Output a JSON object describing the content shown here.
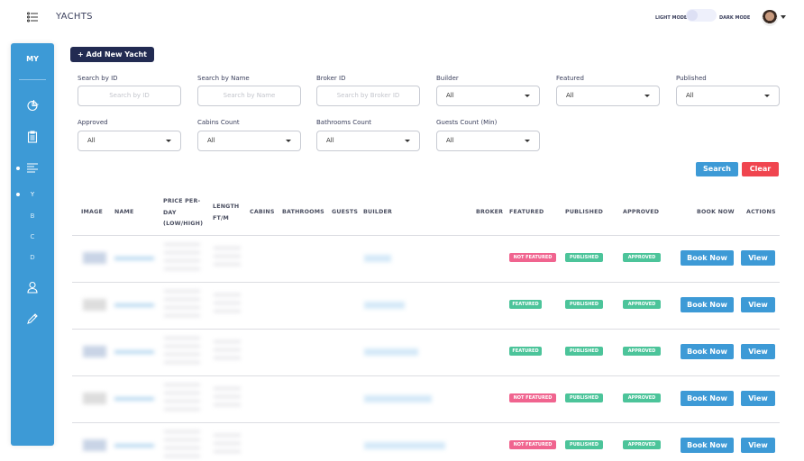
{
  "header": {
    "title": "YACHTS",
    "light_mode": "LIGHT MODE",
    "dark_mode": "DARK MODE"
  },
  "sidebar": {
    "brand": "MY",
    "sub_items": [
      "Y",
      "B",
      "C",
      "D"
    ]
  },
  "toolbar": {
    "add_label": "Add New Yacht"
  },
  "filters": [
    {
      "label": "Search by ID",
      "placeholder": "Search by ID",
      "type": "input"
    },
    {
      "label": "Search by Name",
      "placeholder": "Search by Name",
      "type": "input"
    },
    {
      "label": "Broker ID",
      "placeholder": "Search by Broker ID",
      "type": "input"
    },
    {
      "label": "Builder",
      "value": "All",
      "type": "select"
    },
    {
      "label": "Featured",
      "value": "All",
      "type": "select"
    },
    {
      "label": "Published",
      "value": "All",
      "type": "select"
    },
    {
      "label": "Approved",
      "value": "All",
      "type": "select"
    },
    {
      "label": "Cabins Count",
      "value": "All",
      "type": "select"
    },
    {
      "label": "Bathrooms Count",
      "value": "All",
      "type": "select"
    },
    {
      "label": "Guests Count (Min)",
      "value": "All",
      "type": "select"
    }
  ],
  "search_label": "Search",
  "clear_label": "Clear",
  "table": {
    "headers": [
      "IMAGE",
      "NAME",
      "PRICE PER-DAY (LOW/HIGH)",
      "LENGTH FT/M",
      "CABINS",
      "BATHROOMS",
      "GUESTS",
      "BUILDER",
      "BROKER",
      "FEATURED",
      "PUBLISHED",
      "APPROVED",
      "BOOK NOW",
      "ACTIONS"
    ],
    "rows": [
      {
        "featured": "NOT FEATURED",
        "published": "PUBLISHED",
        "approved": "APPROVED",
        "book": "Book Now",
        "action": "View"
      },
      {
        "featured": "FEATURED",
        "published": "PUBLISHED",
        "approved": "APPROVED",
        "book": "Book Now",
        "action": "View"
      },
      {
        "featured": "FEATURED",
        "published": "PUBLISHED",
        "approved": "APPROVED",
        "book": "Book Now",
        "action": "View"
      },
      {
        "featured": "NOT FEATURED",
        "published": "PUBLISHED",
        "approved": "APPROVED",
        "book": "Book Now",
        "action": "View"
      },
      {
        "featured": "NOT FEATURED",
        "published": "PUBLISHED",
        "approved": "APPROVED",
        "book": "Book Now",
        "action": "View"
      }
    ]
  },
  "colors": {
    "sidebar": "#3d9ad6",
    "primary": "#222b52",
    "danger": "#f0454f",
    "featured_no": "#f0648f",
    "success": "#4cc49a"
  }
}
